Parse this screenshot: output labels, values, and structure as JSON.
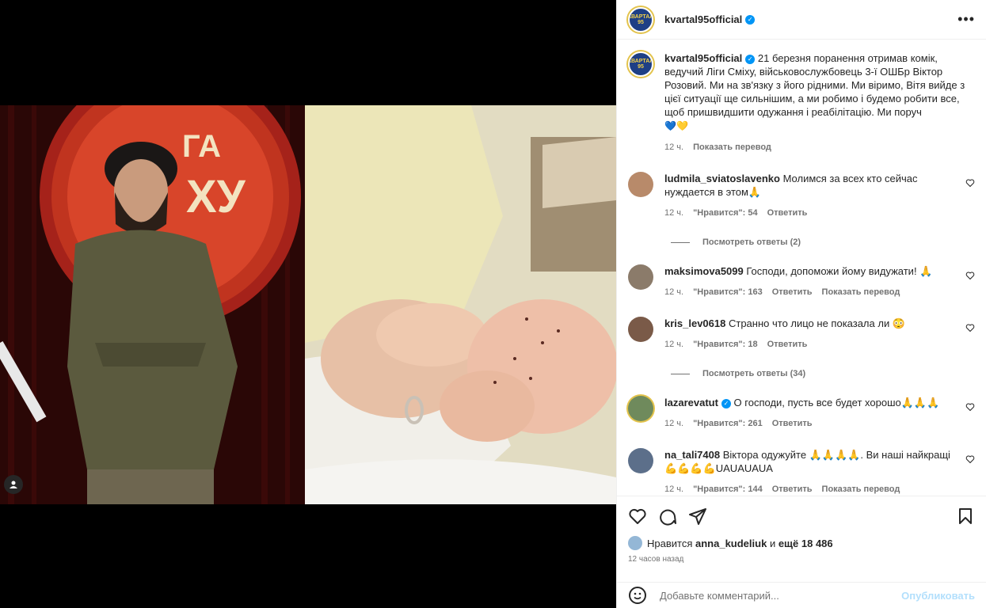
{
  "post": {
    "username": "kvartal95official",
    "brand_logo_text": "КВАРТАЛ 95",
    "caption": "21 березня поранення отримав комік, ведучий Ліги Сміху, військовослужбовець 3-ї ОШБр Віктор Розовий. Ми на зв'язку з його рідними. Ми віримо, Вітя вийде з цієї ситуації ще сильнішим, а ми робимо і будемо робити все, щоб пришвидшити одужання і реабілітацію. Ми поруч",
    "caption_emoji": "💙💛",
    "caption_time": "12 ч.",
    "translate": "Показать перевод"
  },
  "comments": [
    {
      "user": "ludmila_sviatoslavenko",
      "text": "Молимся за всех кто сейчас нуждается в этом🙏",
      "time": "12 ч.",
      "likes": "\"Нравится\": 54",
      "reply": "Ответить",
      "translate": "",
      "replies": "Посмотреть ответы (2)",
      "avatar_color": "#b88a6a"
    },
    {
      "user": "maksimova5099",
      "text": "Господи, допоможи йому видужати! 🙏",
      "time": "12 ч.",
      "likes": "\"Нравится\": 163",
      "reply": "Ответить",
      "translate": "Показать перевод",
      "replies": "",
      "avatar_color": "#8b7b6a"
    },
    {
      "user": "kris_lev0618",
      "text": "Странно что лицо не показала ли 😳",
      "time": "12 ч.",
      "likes": "\"Нравится\": 18",
      "reply": "Ответить",
      "translate": "",
      "replies": "Посмотреть ответы (34)",
      "avatar_color": "#7a5a48"
    },
    {
      "user": "lazarevatut",
      "text": "О господи, пусть все будет хорошо🙏🙏🙏",
      "time": "12 ч.",
      "likes": "\"Нравится\": 261",
      "reply": "Ответить",
      "translate": "",
      "replies": "",
      "avatar_color": "#6f8a5c"
    },
    {
      "user": "na_tali7408",
      "text": "Віктора одужуйте 🙏🙏🙏🙏. Ви наші найкращі 💪💪💪💪UAUAUAUA",
      "time": "12 ч.",
      "likes": "\"Нравится\": 144",
      "reply": "Ответить",
      "translate": "Показать перевод",
      "replies": "",
      "avatar_color": "#5c6f8a"
    }
  ],
  "likes": {
    "prefix": "Нравится",
    "user": "anna_kudeliuk",
    "and": "и",
    "rest": "ещё 18 486",
    "time": "12 часов назад"
  },
  "add_comment": {
    "placeholder": "Добавьте комментарий...",
    "publish": "Опубликовать"
  },
  "colors": {
    "accent": "#0095f6",
    "muted": "#737373"
  }
}
